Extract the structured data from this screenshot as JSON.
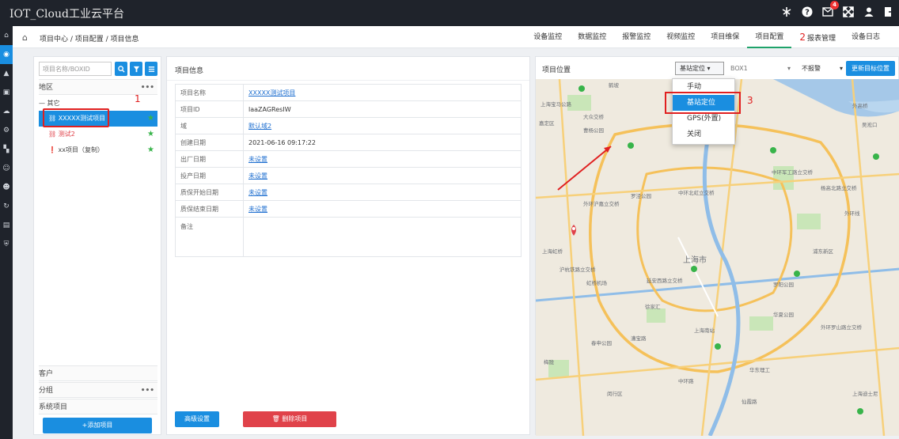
{
  "app": {
    "title": "IOT_Cloud工业云平台"
  },
  "topbar": {
    "badge_count": "4"
  },
  "breadcrumb": {
    "path": "项目中心 / 项目配置 / 项目信息"
  },
  "topnav": [
    {
      "label": "设备监控"
    },
    {
      "label": "数据监控"
    },
    {
      "label": "报警监控"
    },
    {
      "label": "视频监控"
    },
    {
      "label": "项目维保"
    },
    {
      "label": "项目配置"
    },
    {
      "label": "报表管理"
    },
    {
      "label": "设备日志"
    }
  ],
  "annotations": {
    "one": "1",
    "two": "2",
    "three": "3"
  },
  "left": {
    "search_placeholder": "项目名称/BOXID",
    "region_label": "地区",
    "more": "•••",
    "tree": [
      {
        "label": "— 其它"
      },
      {
        "label": "⛓ XXXXX测试项目"
      },
      {
        "label": "⛓ 测试2"
      },
      {
        "label": "❗ xx项目（复制）"
      }
    ],
    "customer_label": "客户",
    "group_label": "分组",
    "system_label": "系统项目",
    "add_button": "+添加项目"
  },
  "project_info": {
    "title": "项目信息",
    "rows": [
      {
        "key": "项目名称",
        "value": "XXXXX测试项目"
      },
      {
        "key": "项目ID",
        "value": "laaZAGResIW"
      },
      {
        "key": "域",
        "value": "默认域2"
      },
      {
        "key": "创建日期",
        "value": "2021-06-16 09:17:22"
      },
      {
        "key": "出厂日期",
        "value": "未设置"
      },
      {
        "key": "投产日期",
        "value": "未设置"
      },
      {
        "key": "质保开始日期",
        "value": "未设置"
      },
      {
        "key": "质保结束日期",
        "value": "未设置"
      },
      {
        "key": "备注",
        "value": ""
      }
    ],
    "advanced_button": "高级设置",
    "delete_button": "删除项目"
  },
  "project_location": {
    "title": "项目位置",
    "locate_select": "基站定位",
    "box_select": "BOX1",
    "alarm_select": "不报警",
    "update_button": "更新目标位置",
    "dropdown_options": [
      {
        "label": "手动"
      },
      {
        "label": "基站定位"
      },
      {
        "label": "GPS(外置)"
      },
      {
        "label": "关闭"
      }
    ]
  },
  "map": {
    "labels": [
      "上海宝马公路",
      "鹤坡",
      "嘉定区",
      "大众交桥",
      "曹杨公园",
      "外环沪嘉立交桥",
      "中环北虹立交桥",
      "上海市",
      "中环军工路立交桥",
      "杨高北路立交桥",
      "上海虹桥",
      "虹桥机场",
      "沪杭铁路立交桥",
      "延安西路立交桥",
      "徐家汇",
      "漕宝路",
      "上海南站",
      "华东理工",
      "罗阳公园",
      "外环罗山路立交桥",
      "上海迪士尼",
      "外环线",
      "春申公园",
      "中环路",
      "外高桥",
      "罗泾公园",
      "吴淞口",
      "浦东新区",
      "华夏公园",
      "闵行区",
      "梅陇",
      "仙霞路"
    ]
  },
  "colors": {
    "accent": "#1a8ee0",
    "danger": "#e0424a",
    "green": "#38b44a",
    "annotation": "#e02020"
  }
}
